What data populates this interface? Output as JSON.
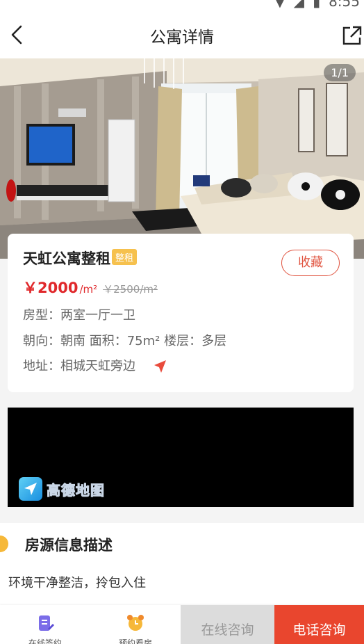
{
  "status_bar": {
    "time": "8:55"
  },
  "navbar": {
    "title": "公寓详情"
  },
  "gallery": {
    "counter": "1/1"
  },
  "listing": {
    "title": "天虹公寓整租",
    "tag": "整租",
    "favorite_label": "收藏",
    "price": "￥2000",
    "price_unit": "/m²",
    "original_price": "￥2500/m²",
    "layout": "房型：两室一厅一卫",
    "orientation_area_floor": "朝向：朝南 面积：75m² 楼层：多层",
    "address": "地址：相城天虹旁边"
  },
  "map": {
    "logo_text": "高德地图"
  },
  "description": {
    "heading": "房源信息描述",
    "text": "环境干净整洁，拎包入住"
  },
  "bottom_bar": {
    "tab_sign": "在线签约",
    "tab_viewing": "预约看房",
    "online_consult": "在线咨询",
    "phone_consult": "电话咨询"
  },
  "colors": {
    "accent": "#e9462e",
    "price": "#e0282b",
    "tag": "#f6c14e",
    "section_mark": "#f6b839"
  }
}
